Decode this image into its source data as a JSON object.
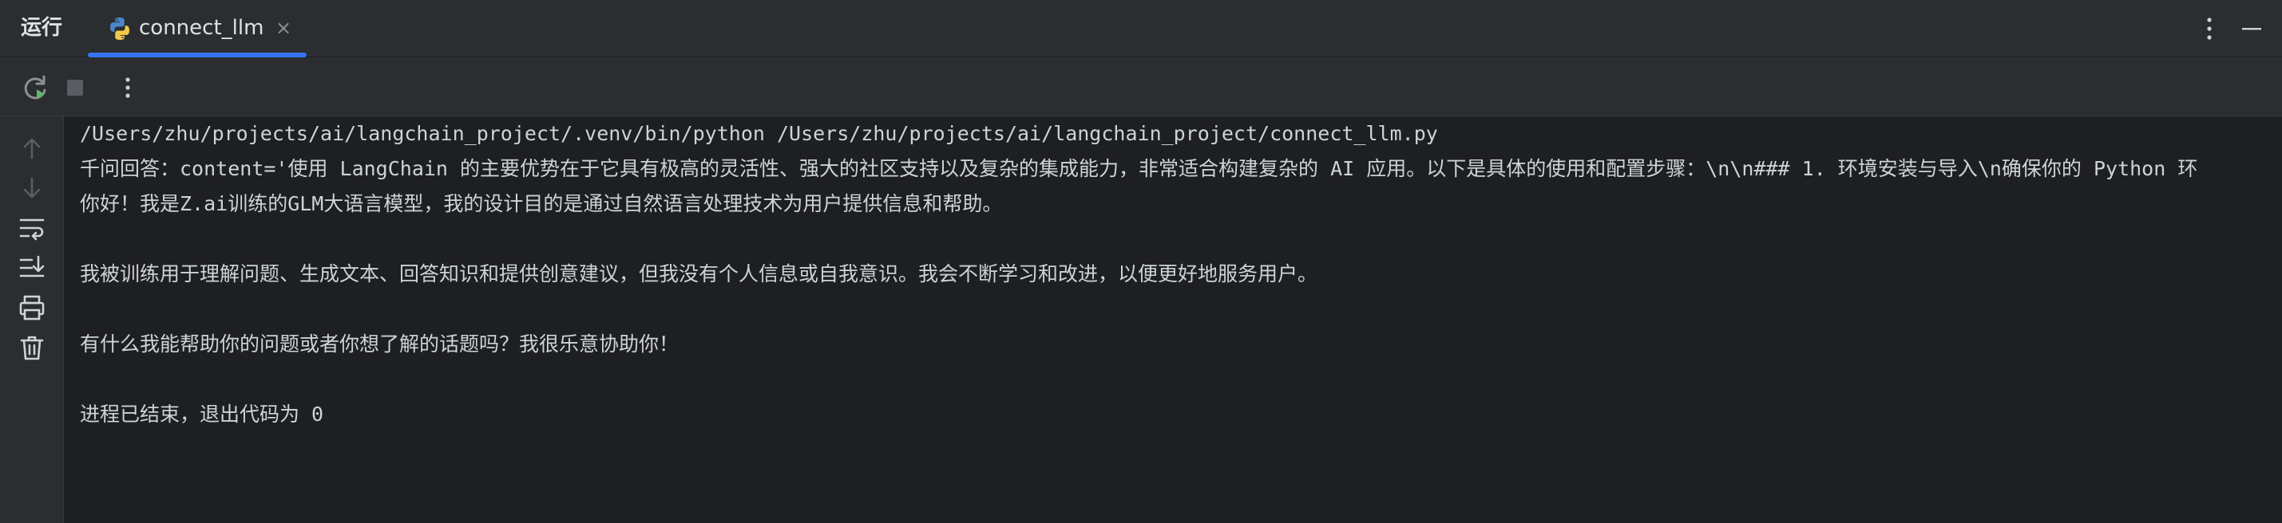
{
  "panel": {
    "title": "运行"
  },
  "tab": {
    "label": "connect_llm",
    "icon": "python-icon",
    "close_glyph": "×"
  },
  "toolbar": {
    "rerun_icon": "rerun-icon",
    "stop_icon": "stop-icon",
    "more_icon": "more-vertical-icon"
  },
  "gutter": {
    "icons": [
      "arrow-up-icon",
      "arrow-down-icon",
      "soft-wrap-icon",
      "scroll-to-end-icon",
      "print-icon",
      "trash-icon"
    ]
  },
  "console": {
    "lines": [
      "/Users/zhu/projects/ai/langchain_project/.venv/bin/python /Users/zhu/projects/ai/langchain_project/connect_llm.py",
      "千问回答：content='使用 LangChain 的主要优势在于它具有极高的灵活性、强大的社区支持以及复杂的集成能力，非常适合构建复杂的 AI 应用。以下是具体的使用和配置步骤：\\n\\n### 1. 环境安装与导入\\n确保你的 Python 环",
      "你好！我是Z.ai训练的GLM大语言模型，我的设计目的是通过自然语言处理技术为用户提供信息和帮助。",
      "",
      "我被训练用于理解问题、生成文本、回答知识和提供创意建议，但我没有个人信息或自我意识。我会不断学习和改进，以便更好地服务用户。",
      "",
      "有什么我能帮助你的问题或者你想了解的话题吗？我很乐意协助你！",
      "",
      "进程已结束，退出代码为 0"
    ]
  },
  "colors": {
    "background": "#1e1f22",
    "panel": "#2b2d30",
    "accent": "#3574f0",
    "rerun_green": "#5fb865",
    "text": "#cfd2d6",
    "icon": "#8c8f94"
  }
}
